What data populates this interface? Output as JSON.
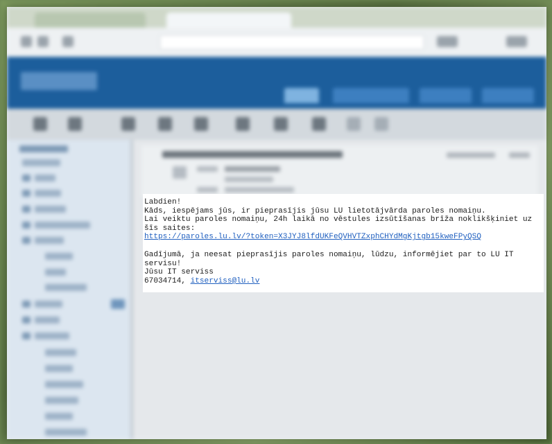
{
  "email": {
    "greeting": "Labdien!",
    "line1": "Kāds, iespējams jūs, ir pieprasījis jūsu LU lietotājvārda paroles nomaiņu.",
    "line2a": "Lai veiktu paroles nomaiņu, 24h laikā no vēstules izsūtīšanas brīža noklikšķiniet uz",
    "line2b": "šīs saites:",
    "reset_link": "https://paroles.lu.lv/?token=X3JYJ8lfdUKFeQVHVTZxphCHYdMgKjtgb15kweFPyQSQ",
    "line3a": "Gadījumā, ja neesat pieprasījis paroles nomaiņu, lūdzu, informējiet par to LU IT",
    "line3b": "servisu!",
    "signature": "Jūsu IT serviss",
    "phone": "67034714, ",
    "email_link": "itserviss@lu.lv"
  },
  "colors": {
    "header_blue": "#1c5e9c",
    "link_blue": "#1f5fbf",
    "sidebar_bg": "#dce6f0"
  },
  "icons": [
    "back-icon",
    "forward-icon",
    "reload-icon",
    "mail-toolbar-icon",
    "folder-icon"
  ]
}
